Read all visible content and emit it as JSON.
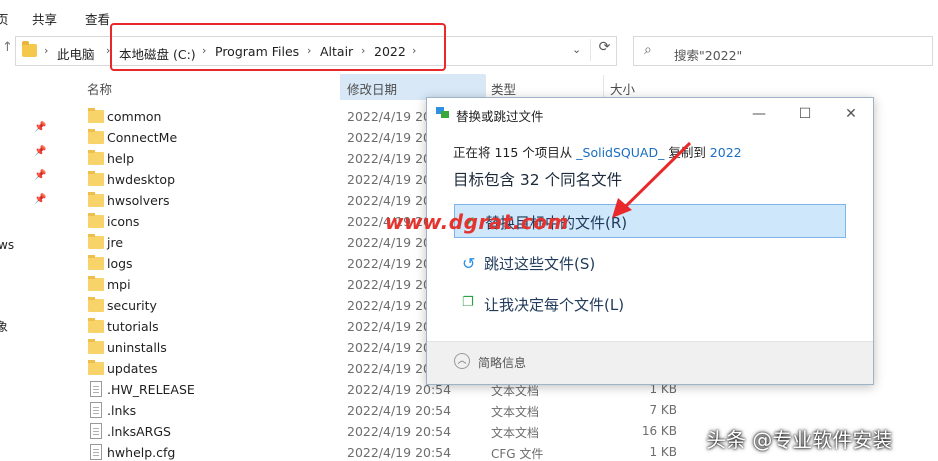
{
  "ribbon": {
    "tab_partial": "页",
    "share": "共享",
    "view": "查看"
  },
  "address": {
    "crumbs": [
      "此电脑",
      "本地磁盘 (C:)",
      "Program Files",
      "Altair",
      "2022"
    ]
  },
  "search": {
    "placeholder": "搜索\"2022\""
  },
  "leftnav": {
    "frag1": "ws",
    "frag2": "象"
  },
  "columns": {
    "name": "名称",
    "date": "修改日期",
    "type": "类型",
    "size": "大小"
  },
  "files": [
    {
      "name": "common",
      "kind": "folder",
      "date": "2022/4/19 20:",
      "type": "",
      "size": ""
    },
    {
      "name": "ConnectMe",
      "kind": "folder",
      "date": "2022/4/19 20:",
      "type": "",
      "size": ""
    },
    {
      "name": "help",
      "kind": "folder",
      "date": "2022/4/19 20:",
      "type": "",
      "size": ""
    },
    {
      "name": "hwdesktop",
      "kind": "folder",
      "date": "2022/4/19 20:",
      "type": "",
      "size": ""
    },
    {
      "name": "hwsolvers",
      "kind": "folder",
      "date": "2022/4/19 20:",
      "type": "",
      "size": ""
    },
    {
      "name": "icons",
      "kind": "folder",
      "date": "2022/4/19 20:",
      "type": "",
      "size": ""
    },
    {
      "name": "jre",
      "kind": "folder",
      "date": "2022/4/19 20:",
      "type": "",
      "size": ""
    },
    {
      "name": "logs",
      "kind": "folder",
      "date": "2022/4/19 20:",
      "type": "",
      "size": ""
    },
    {
      "name": "mpi",
      "kind": "folder",
      "date": "2022/4/19 20:",
      "type": "",
      "size": ""
    },
    {
      "name": "security",
      "kind": "folder",
      "date": "2022/4/19 20:",
      "type": "",
      "size": ""
    },
    {
      "name": "tutorials",
      "kind": "folder",
      "date": "2022/4/19 20:",
      "type": "",
      "size": ""
    },
    {
      "name": "uninstalls",
      "kind": "folder",
      "date": "2022/4/19 20:",
      "type": "",
      "size": ""
    },
    {
      "name": "updates",
      "kind": "folder",
      "date": "2022/4/19 20:",
      "type": "",
      "size": ""
    },
    {
      "name": ".HW_RELEASE",
      "kind": "doc",
      "date": "2022/4/19 20:54",
      "type": "文本文档",
      "size": "1 KB"
    },
    {
      "name": ".lnks",
      "kind": "doc",
      "date": "2022/4/19 20:54",
      "type": "文本文档",
      "size": "7 KB"
    },
    {
      "name": ".lnksARGS",
      "kind": "doc",
      "date": "2022/4/19 20:54",
      "type": "文本文档",
      "size": "16 KB"
    },
    {
      "name": "hwhelp.cfg",
      "kind": "doc",
      "date": "2022/4/19 20:54",
      "type": "CFG 文件",
      "size": "1 KB"
    }
  ],
  "dialog": {
    "title": "替换或跳过文件",
    "line1_pre": "正在将 115 个项目从 ",
    "line1_src": "_SolidSQUAD_",
    "line1_mid": " 复制到 ",
    "line1_dst": "2022",
    "line2": "目标包含 32 个同名文件",
    "opt_replace": "替换目标中的文件(R)",
    "opt_skip": "跳过这些文件(S)",
    "opt_decide": "让我决定每个文件(L)",
    "footer": "简略信息"
  },
  "watermark": "www.dgrat.com",
  "brand": "头条 @专业软件安装",
  "colors": {
    "highlight": "#cfe7fb",
    "red": "#e8282b",
    "link": "#1b6ec2"
  }
}
